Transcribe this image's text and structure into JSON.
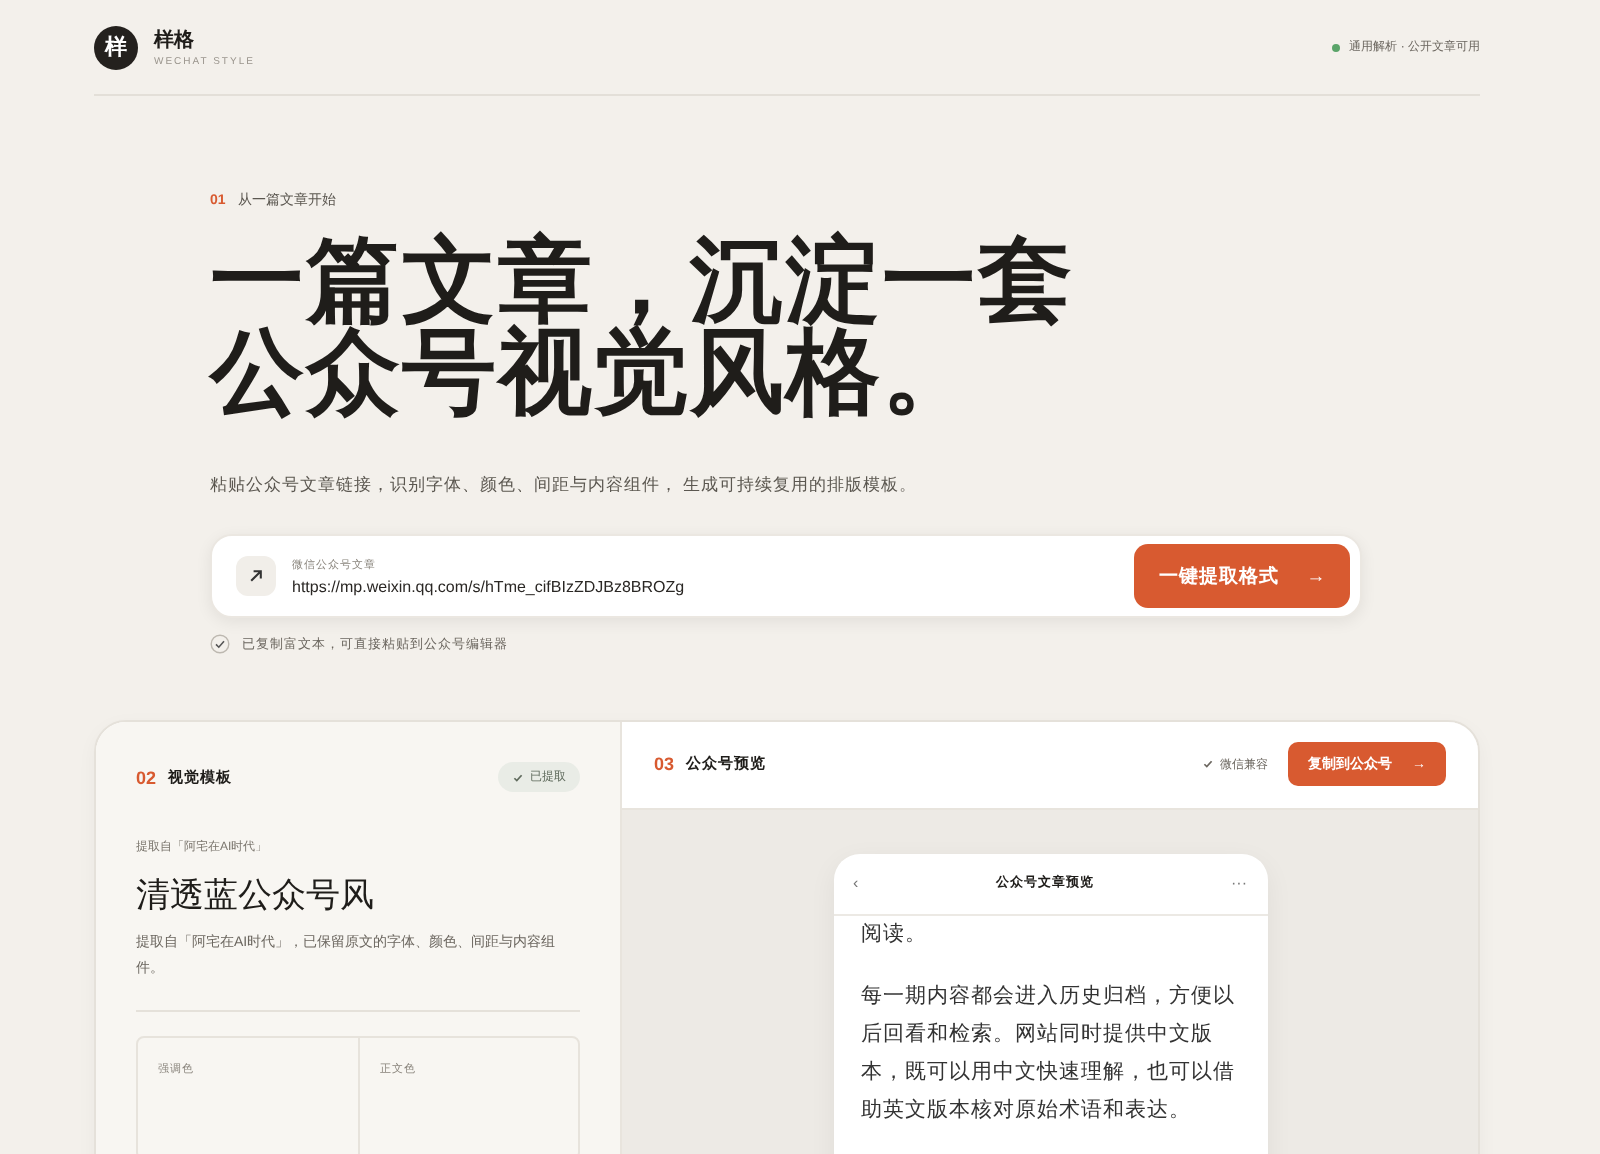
{
  "header": {
    "logo_mark": "样",
    "brand": "样格",
    "subtitle": "WECHAT STYLE",
    "status": "通用解析 · 公开文章可用"
  },
  "hero": {
    "step": "01",
    "eyebrow": "从一篇文章开始",
    "headline": [
      "一篇文章，沉淀一套",
      "公众号视觉风格。"
    ],
    "intro": "粘贴公众号文章链接，识别字体、颜色、间距与内容组件， 生成可持续复用的排版模板。"
  },
  "link_input": {
    "label": "微信公众号文章",
    "value": "https://mp.weixin.qq.com/s/hTme_cifBIzZDJBz8BROZg",
    "button": "一键提取格式",
    "button_arrow": "→"
  },
  "note": "已复制富文本，可直接粘贴到公众号编辑器",
  "template_panel": {
    "step": "02",
    "title": "视觉模板",
    "badge": "已提取",
    "source": "提取自「阿宅在AI时代」",
    "name": "清透蓝公众号风",
    "description": "提取自「阿宅在AI时代」，已保留原文的字体、颜色、间距与内容组件。",
    "swatches": [
      {
        "label": "强调色"
      },
      {
        "label": "正文色"
      }
    ]
  },
  "preview_panel": {
    "step": "03",
    "title": "公众号预览",
    "compat": "微信兼容",
    "copy_button": "复制到公众号",
    "copy_arrow": "→",
    "phone": {
      "back": "‹",
      "title": "公众号文章预览",
      "more": "···",
      "paragraphs": [
        "阅读。",
        "每一期内容都会进入历史归档，方便以后回看和检索。网站同时提供中文版本，既可以用中文快速理解，也可以借助英文版本核对原始术语和表达。"
      ]
    }
  }
}
